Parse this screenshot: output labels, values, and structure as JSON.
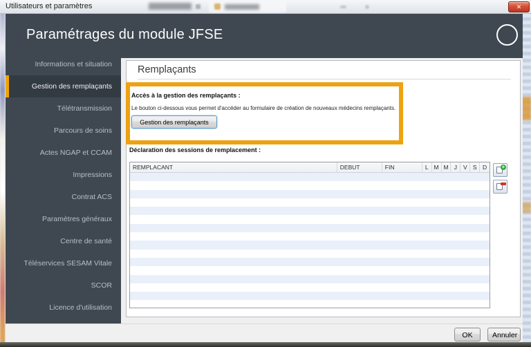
{
  "titlebar": {
    "title": "Utilisateurs et paramètres",
    "close_glyph": "✕"
  },
  "header": {
    "title": "Paramétrages du module JFSE"
  },
  "sidebar": {
    "items": [
      {
        "label": "Informations et situation",
        "active": false
      },
      {
        "label": "Gestion des remplaçants",
        "active": true
      },
      {
        "label": "Télétransmission",
        "active": false
      },
      {
        "label": "Parcours de soins",
        "active": false
      },
      {
        "label": "Actes NGAP et CCAM",
        "active": false
      },
      {
        "label": "Impressions",
        "active": false
      },
      {
        "label": "Contrat ACS",
        "active": false
      },
      {
        "label": "Paramètres généraux",
        "active": false
      },
      {
        "label": "Centre de santé",
        "active": false
      },
      {
        "label": "Téléservices SESAM Vitale",
        "active": false
      },
      {
        "label": "SCOR",
        "active": false
      },
      {
        "label": "Licence d'utilisation",
        "active": false
      }
    ]
  },
  "content": {
    "heading": "Remplaçants",
    "access_section": {
      "label": "Accès à la gestion des remplaçants :",
      "description": "Le bouton ci-dessous vous permet d'accéder au formulaire de création de nouveaux médecins remplaçants.",
      "button_label": "Gestion des remplaçants",
      "highlight_color": "#EDA211"
    },
    "sessions_section": {
      "label": "Déclaration des sessions de remplacement :",
      "table": {
        "columns": [
          "REMPLACANT",
          "DEBUT",
          "FIN",
          "L",
          "M",
          "M",
          "J",
          "V",
          "S",
          "D"
        ],
        "rows": [],
        "empty_row_count": 16,
        "stripe_color": "#E9F0F9"
      },
      "tool_buttons": [
        {
          "name": "add-session",
          "icon": "document-plus-icon"
        },
        {
          "name": "remove-session",
          "icon": "document-minus-icon"
        }
      ]
    }
  },
  "footer": {
    "ok_label": "OK",
    "cancel_label": "Annuler"
  },
  "colors": {
    "header_bg": "#3F4851",
    "sidebar_active_bg": "#333B42",
    "accent_orange": "#EDA211",
    "active_bar_orange": "#F0A30A",
    "close_button_red": "#C74634",
    "table_stripe_blue": "#E9F0F9"
  }
}
